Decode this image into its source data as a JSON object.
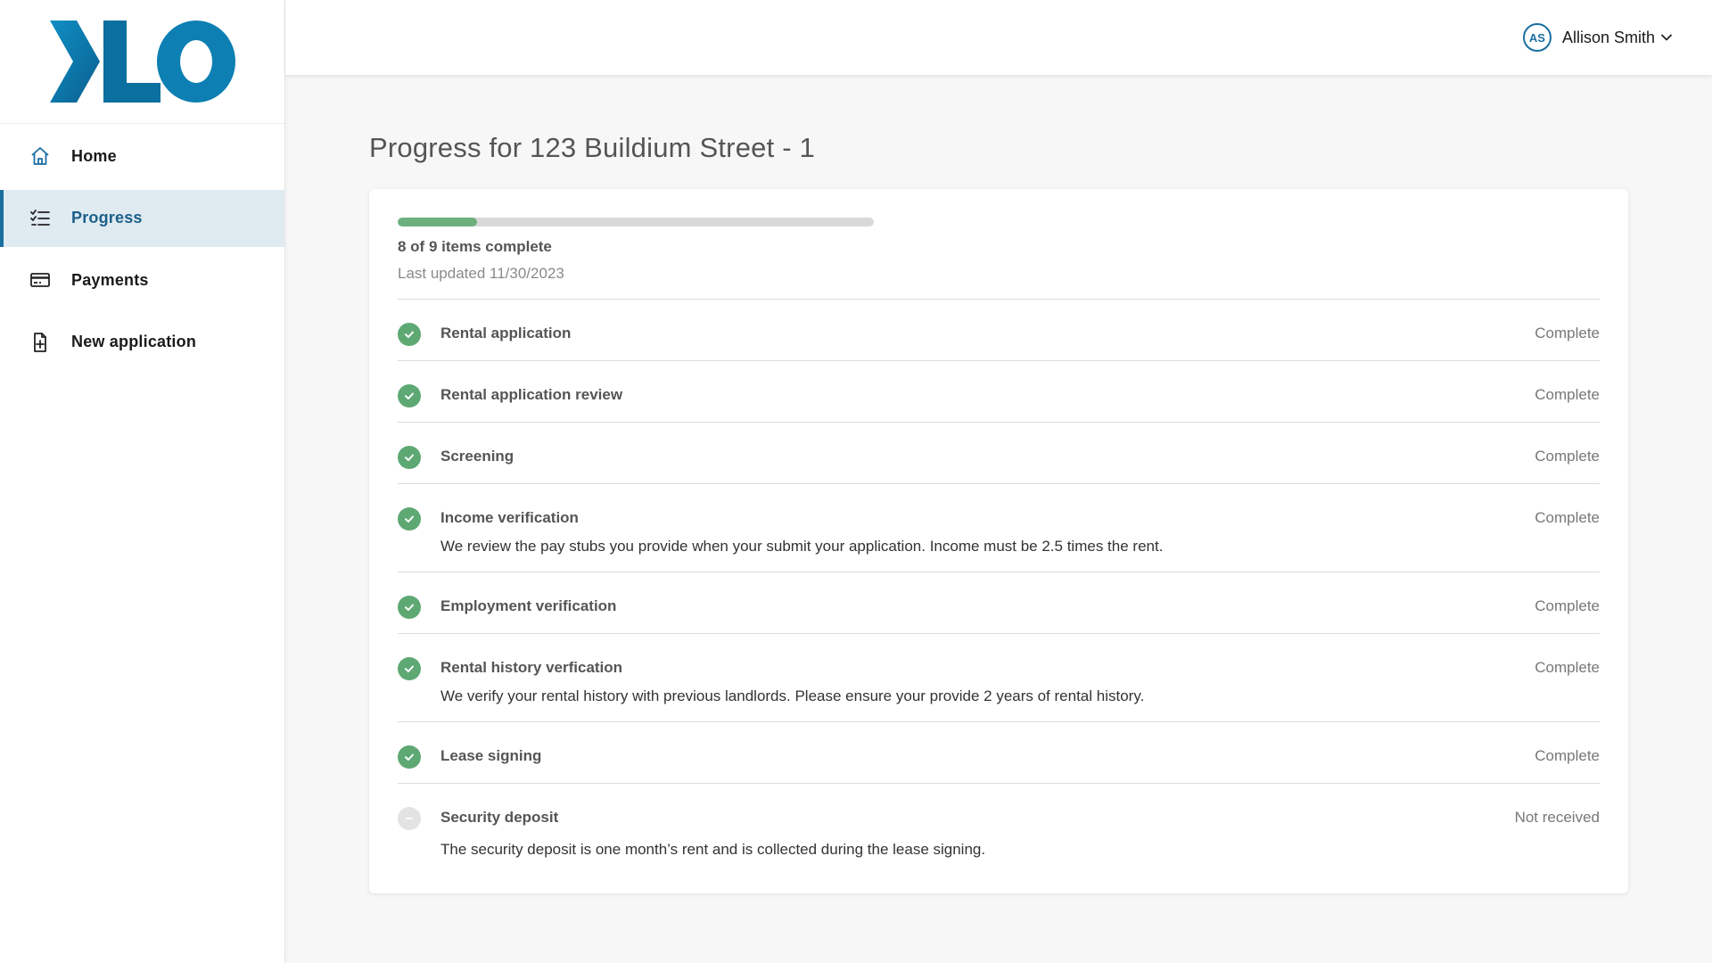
{
  "user": {
    "initials": "AS",
    "name": "Allison Smith"
  },
  "nav": [
    {
      "label": "Home",
      "icon": "home-icon",
      "active": false
    },
    {
      "label": "Progress",
      "icon": "checklist-icon",
      "active": true
    },
    {
      "label": "Payments",
      "icon": "credit-card-icon",
      "active": false
    },
    {
      "label": "New application",
      "icon": "file-add-icon",
      "active": false
    }
  ],
  "page": {
    "title": "Progress for 123 Buildium Street - 1"
  },
  "progress": {
    "completed": 8,
    "total": 9,
    "fraction": 0.1667,
    "count_text": "8 of 9 items complete",
    "updated_text": "Last updated 11/30/2023"
  },
  "steps": [
    {
      "title": "Rental application",
      "status": "Complete",
      "description": ""
    },
    {
      "title": "Rental application review",
      "status": "Complete",
      "description": ""
    },
    {
      "title": "Screening",
      "status": "Complete",
      "description": ""
    },
    {
      "title": "Income verification",
      "status": "Complete",
      "description": "We review the pay stubs you provide when your submit your application. Income must be 2.5 times the rent."
    },
    {
      "title": "Employment verification",
      "status": "Complete",
      "description": ""
    },
    {
      "title": "Rental history verfication",
      "status": "Complete",
      "description": "We verify your rental history with previous landlords. Please ensure your provide 2 years of rental history."
    },
    {
      "title": "Lease signing",
      "status": "Complete",
      "description": ""
    },
    {
      "title": "Security deposit",
      "status": "Not received",
      "description": "The security deposit is one month’s rent and is collected during the lease signing."
    }
  ],
  "colors": {
    "brand": "#1a6fa0",
    "success": "#5ea874",
    "progress_fill": "#6db07e",
    "pending": "#e3e3e3"
  }
}
